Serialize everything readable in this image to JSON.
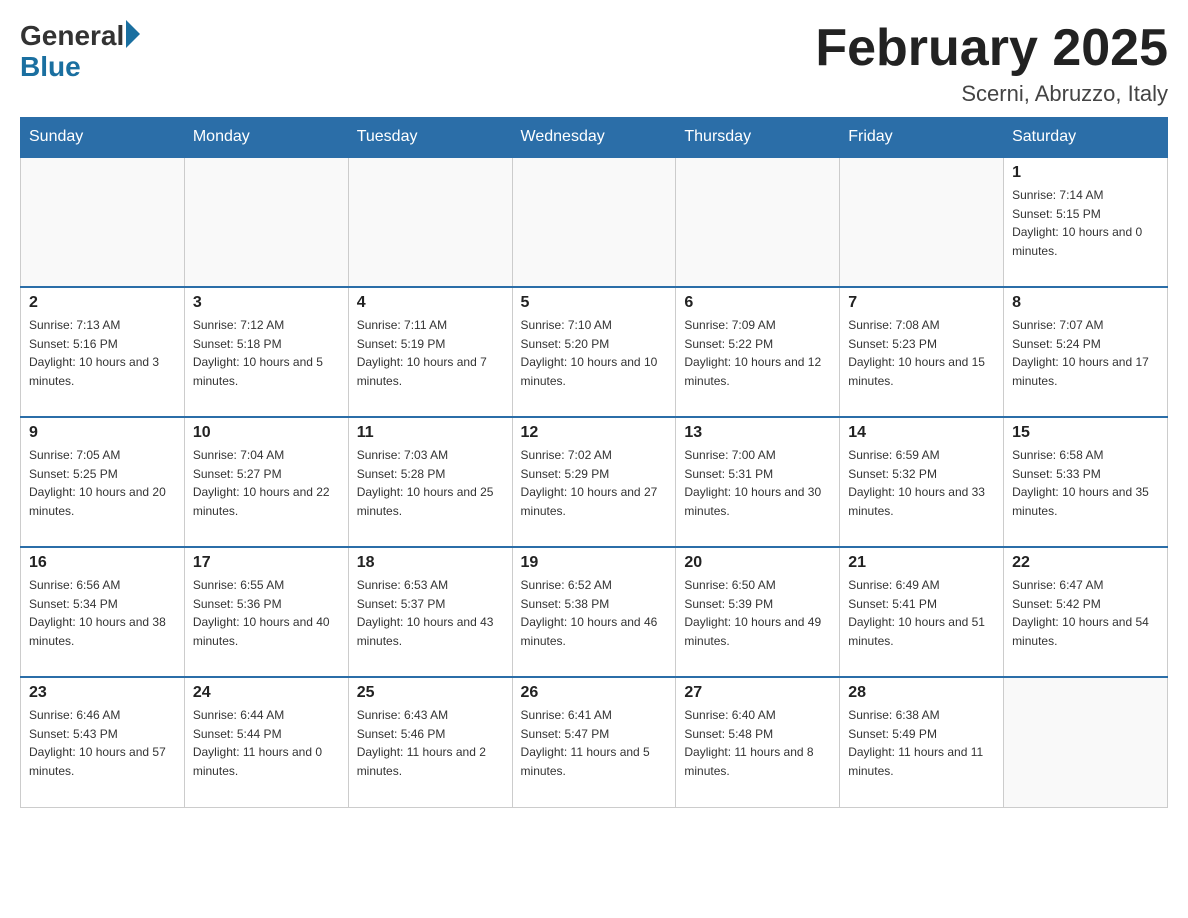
{
  "header": {
    "logo_general": "General",
    "logo_blue": "Blue",
    "month_title": "February 2025",
    "subtitle": "Scerni, Abruzzo, Italy"
  },
  "weekdays": [
    "Sunday",
    "Monday",
    "Tuesday",
    "Wednesday",
    "Thursday",
    "Friday",
    "Saturday"
  ],
  "weeks": [
    [
      {
        "day": "",
        "info": ""
      },
      {
        "day": "",
        "info": ""
      },
      {
        "day": "",
        "info": ""
      },
      {
        "day": "",
        "info": ""
      },
      {
        "day": "",
        "info": ""
      },
      {
        "day": "",
        "info": ""
      },
      {
        "day": "1",
        "info": "Sunrise: 7:14 AM\nSunset: 5:15 PM\nDaylight: 10 hours and 0 minutes."
      }
    ],
    [
      {
        "day": "2",
        "info": "Sunrise: 7:13 AM\nSunset: 5:16 PM\nDaylight: 10 hours and 3 minutes."
      },
      {
        "day": "3",
        "info": "Sunrise: 7:12 AM\nSunset: 5:18 PM\nDaylight: 10 hours and 5 minutes."
      },
      {
        "day": "4",
        "info": "Sunrise: 7:11 AM\nSunset: 5:19 PM\nDaylight: 10 hours and 7 minutes."
      },
      {
        "day": "5",
        "info": "Sunrise: 7:10 AM\nSunset: 5:20 PM\nDaylight: 10 hours and 10 minutes."
      },
      {
        "day": "6",
        "info": "Sunrise: 7:09 AM\nSunset: 5:22 PM\nDaylight: 10 hours and 12 minutes."
      },
      {
        "day": "7",
        "info": "Sunrise: 7:08 AM\nSunset: 5:23 PM\nDaylight: 10 hours and 15 minutes."
      },
      {
        "day": "8",
        "info": "Sunrise: 7:07 AM\nSunset: 5:24 PM\nDaylight: 10 hours and 17 minutes."
      }
    ],
    [
      {
        "day": "9",
        "info": "Sunrise: 7:05 AM\nSunset: 5:25 PM\nDaylight: 10 hours and 20 minutes."
      },
      {
        "day": "10",
        "info": "Sunrise: 7:04 AM\nSunset: 5:27 PM\nDaylight: 10 hours and 22 minutes."
      },
      {
        "day": "11",
        "info": "Sunrise: 7:03 AM\nSunset: 5:28 PM\nDaylight: 10 hours and 25 minutes."
      },
      {
        "day": "12",
        "info": "Sunrise: 7:02 AM\nSunset: 5:29 PM\nDaylight: 10 hours and 27 minutes."
      },
      {
        "day": "13",
        "info": "Sunrise: 7:00 AM\nSunset: 5:31 PM\nDaylight: 10 hours and 30 minutes."
      },
      {
        "day": "14",
        "info": "Sunrise: 6:59 AM\nSunset: 5:32 PM\nDaylight: 10 hours and 33 minutes."
      },
      {
        "day": "15",
        "info": "Sunrise: 6:58 AM\nSunset: 5:33 PM\nDaylight: 10 hours and 35 minutes."
      }
    ],
    [
      {
        "day": "16",
        "info": "Sunrise: 6:56 AM\nSunset: 5:34 PM\nDaylight: 10 hours and 38 minutes."
      },
      {
        "day": "17",
        "info": "Sunrise: 6:55 AM\nSunset: 5:36 PM\nDaylight: 10 hours and 40 minutes."
      },
      {
        "day": "18",
        "info": "Sunrise: 6:53 AM\nSunset: 5:37 PM\nDaylight: 10 hours and 43 minutes."
      },
      {
        "day": "19",
        "info": "Sunrise: 6:52 AM\nSunset: 5:38 PM\nDaylight: 10 hours and 46 minutes."
      },
      {
        "day": "20",
        "info": "Sunrise: 6:50 AM\nSunset: 5:39 PM\nDaylight: 10 hours and 49 minutes."
      },
      {
        "day": "21",
        "info": "Sunrise: 6:49 AM\nSunset: 5:41 PM\nDaylight: 10 hours and 51 minutes."
      },
      {
        "day": "22",
        "info": "Sunrise: 6:47 AM\nSunset: 5:42 PM\nDaylight: 10 hours and 54 minutes."
      }
    ],
    [
      {
        "day": "23",
        "info": "Sunrise: 6:46 AM\nSunset: 5:43 PM\nDaylight: 10 hours and 57 minutes."
      },
      {
        "day": "24",
        "info": "Sunrise: 6:44 AM\nSunset: 5:44 PM\nDaylight: 11 hours and 0 minutes."
      },
      {
        "day": "25",
        "info": "Sunrise: 6:43 AM\nSunset: 5:46 PM\nDaylight: 11 hours and 2 minutes."
      },
      {
        "day": "26",
        "info": "Sunrise: 6:41 AM\nSunset: 5:47 PM\nDaylight: 11 hours and 5 minutes."
      },
      {
        "day": "27",
        "info": "Sunrise: 6:40 AM\nSunset: 5:48 PM\nDaylight: 11 hours and 8 minutes."
      },
      {
        "day": "28",
        "info": "Sunrise: 6:38 AM\nSunset: 5:49 PM\nDaylight: 11 hours and 11 minutes."
      },
      {
        "day": "",
        "info": ""
      }
    ]
  ]
}
